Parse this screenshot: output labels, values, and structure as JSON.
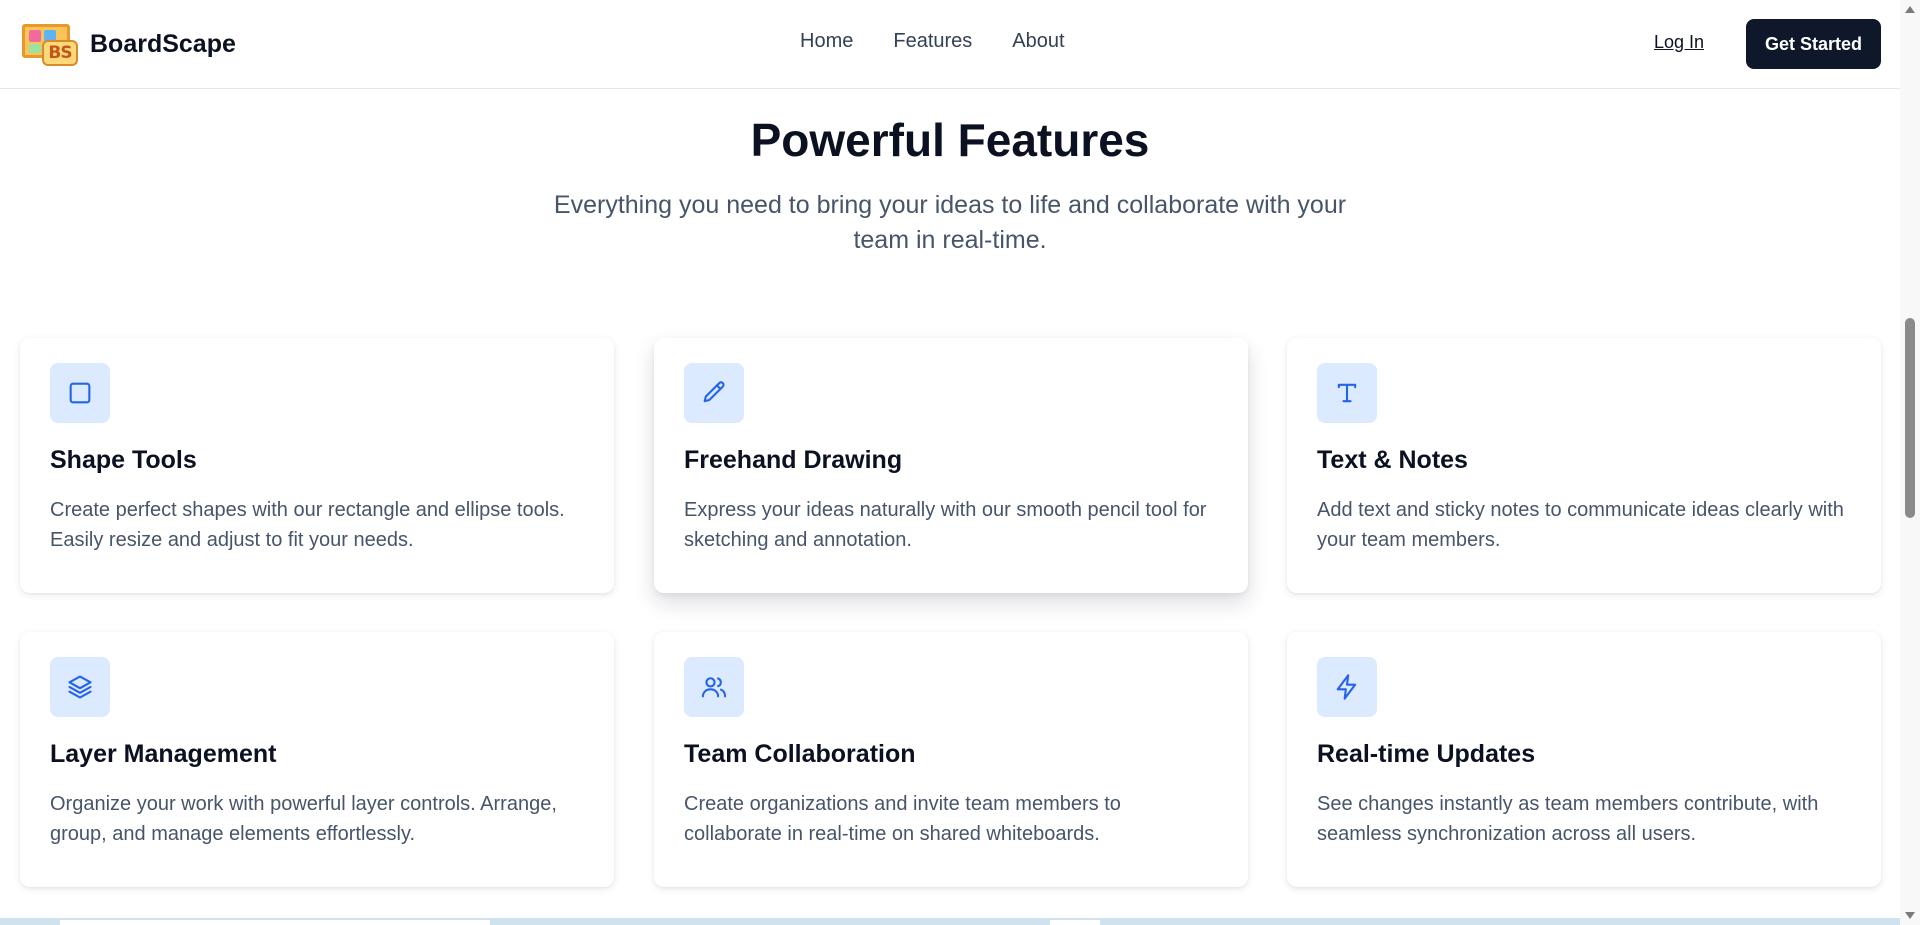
{
  "header": {
    "brand_name": "BoardScape",
    "logo_text": "BS",
    "nav": [
      {
        "label": "Home"
      },
      {
        "label": "Features"
      },
      {
        "label": "About"
      }
    ],
    "login_label": "Log In",
    "cta_label": "Get Started"
  },
  "section": {
    "title": "Powerful Features",
    "subtitle": "Everything you need to bring your ideas to life and collaborate with your team in real-time."
  },
  "features": [
    {
      "icon": "square-icon",
      "title": "Shape Tools",
      "description": "Create perfect shapes with our rectangle and ellipse tools. Easily resize and adjust to fit your needs."
    },
    {
      "icon": "pencil-icon",
      "title": "Freehand Drawing",
      "description": "Express your ideas naturally with our smooth pencil tool for sketching and annotation."
    },
    {
      "icon": "text-icon",
      "title": "Text & Notes",
      "description": "Add text and sticky notes to communicate ideas clearly with your team members."
    },
    {
      "icon": "layers-icon",
      "title": "Layer Management",
      "description": "Organize your work with powerful layer controls. Arrange, group, and manage elements effortlessly."
    },
    {
      "icon": "users-icon",
      "title": "Team Collaboration",
      "description": "Create organizations and invite team members to collaborate in real-time on shared whiteboards."
    },
    {
      "icon": "lightning-icon",
      "title": "Real-time Updates",
      "description": "See changes instantly as team members contribute, with seamless synchronization across all users."
    }
  ],
  "colors": {
    "accent_icon": "#2563eb",
    "icon_bg": "#dbeafe",
    "cta_bg": "#0f172a",
    "text_muted": "#475569"
  }
}
